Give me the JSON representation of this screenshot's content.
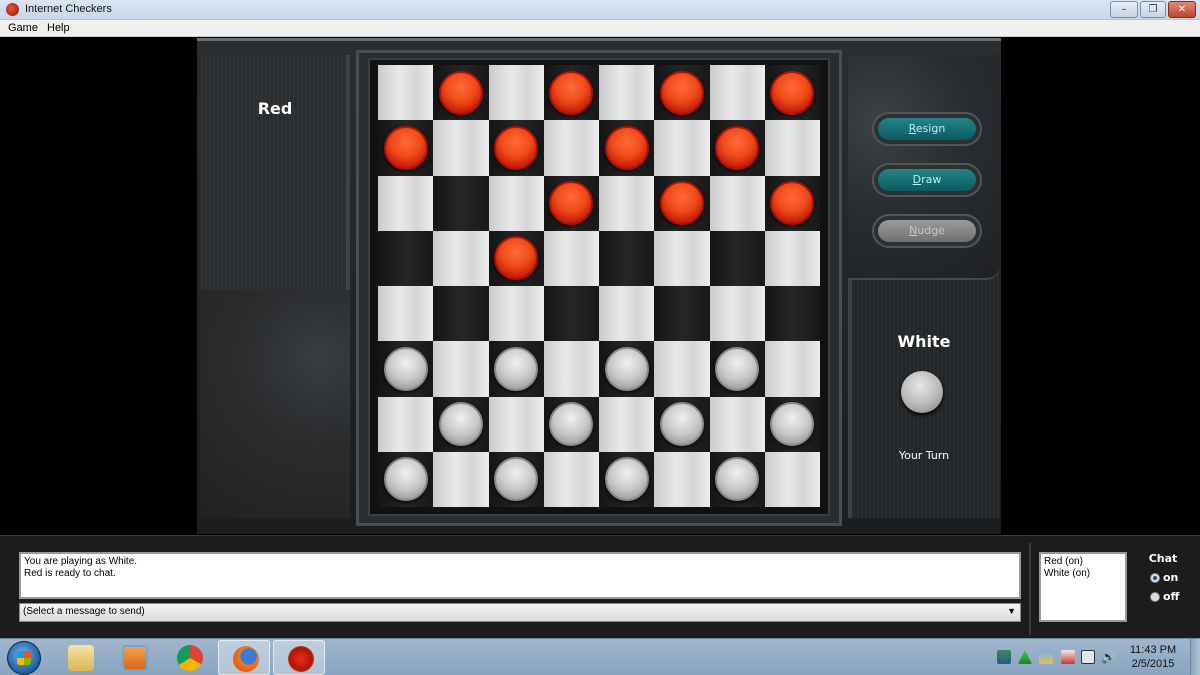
{
  "window": {
    "title": "Internet Checkers",
    "controls": {
      "minimize": "–",
      "restore": "❐",
      "close": "✕"
    }
  },
  "menu": [
    {
      "label": "Game"
    },
    {
      "label": "Help"
    }
  ],
  "players": {
    "top": {
      "name": "Red"
    },
    "bottom": {
      "name": "White",
      "status": "Your Turn"
    }
  },
  "buttons": {
    "resign": {
      "label": "Resign",
      "accesskey": "R",
      "enabled": true
    },
    "draw": {
      "label": "Draw",
      "accesskey": "D",
      "enabled": true
    },
    "nudge": {
      "label": "Nudge",
      "accesskey": "N",
      "enabled": false
    }
  },
  "board": {
    "size": 8,
    "rows": [
      [
        ".",
        "r",
        ".",
        "r",
        ".",
        "r",
        ".",
        "r"
      ],
      [
        "r",
        ".",
        "r",
        ".",
        "r",
        ".",
        "r",
        "."
      ],
      [
        ".",
        ".",
        ".",
        "r",
        ".",
        "r",
        ".",
        "r"
      ],
      [
        ".",
        ".",
        "r",
        ".",
        ".",
        ".",
        ".",
        "."
      ],
      [
        ".",
        ".",
        ".",
        ".",
        ".",
        ".",
        ".",
        "."
      ],
      [
        "w",
        ".",
        "w",
        ".",
        "w",
        ".",
        "w",
        "."
      ],
      [
        ".",
        "w",
        ".",
        "w",
        ".",
        "w",
        ".",
        "w"
      ],
      [
        "w",
        ".",
        "w",
        ".",
        "w",
        ".",
        "w",
        "."
      ]
    ],
    "colors": {
      "red": "#e8401a",
      "white": "#c8c8c8"
    }
  },
  "chat": {
    "log": [
      "You are playing as White.",
      "Red is ready to chat."
    ],
    "select_value": "(Select a message to send)",
    "players": [
      "Red (on)",
      "White (on)"
    ],
    "label": "Chat",
    "options": [
      {
        "label": "on",
        "selected": true
      },
      {
        "label": "off",
        "selected": false
      }
    ]
  },
  "taskbar": {
    "apps": [
      {
        "name": "file-explorer",
        "active": false
      },
      {
        "name": "media-player",
        "active": false
      },
      {
        "name": "chrome",
        "active": false
      },
      {
        "name": "firefox",
        "active": true
      },
      {
        "name": "internet-checkers",
        "active": true
      }
    ],
    "clock": {
      "time": "11:43 PM",
      "date": "2/5/2015"
    }
  }
}
